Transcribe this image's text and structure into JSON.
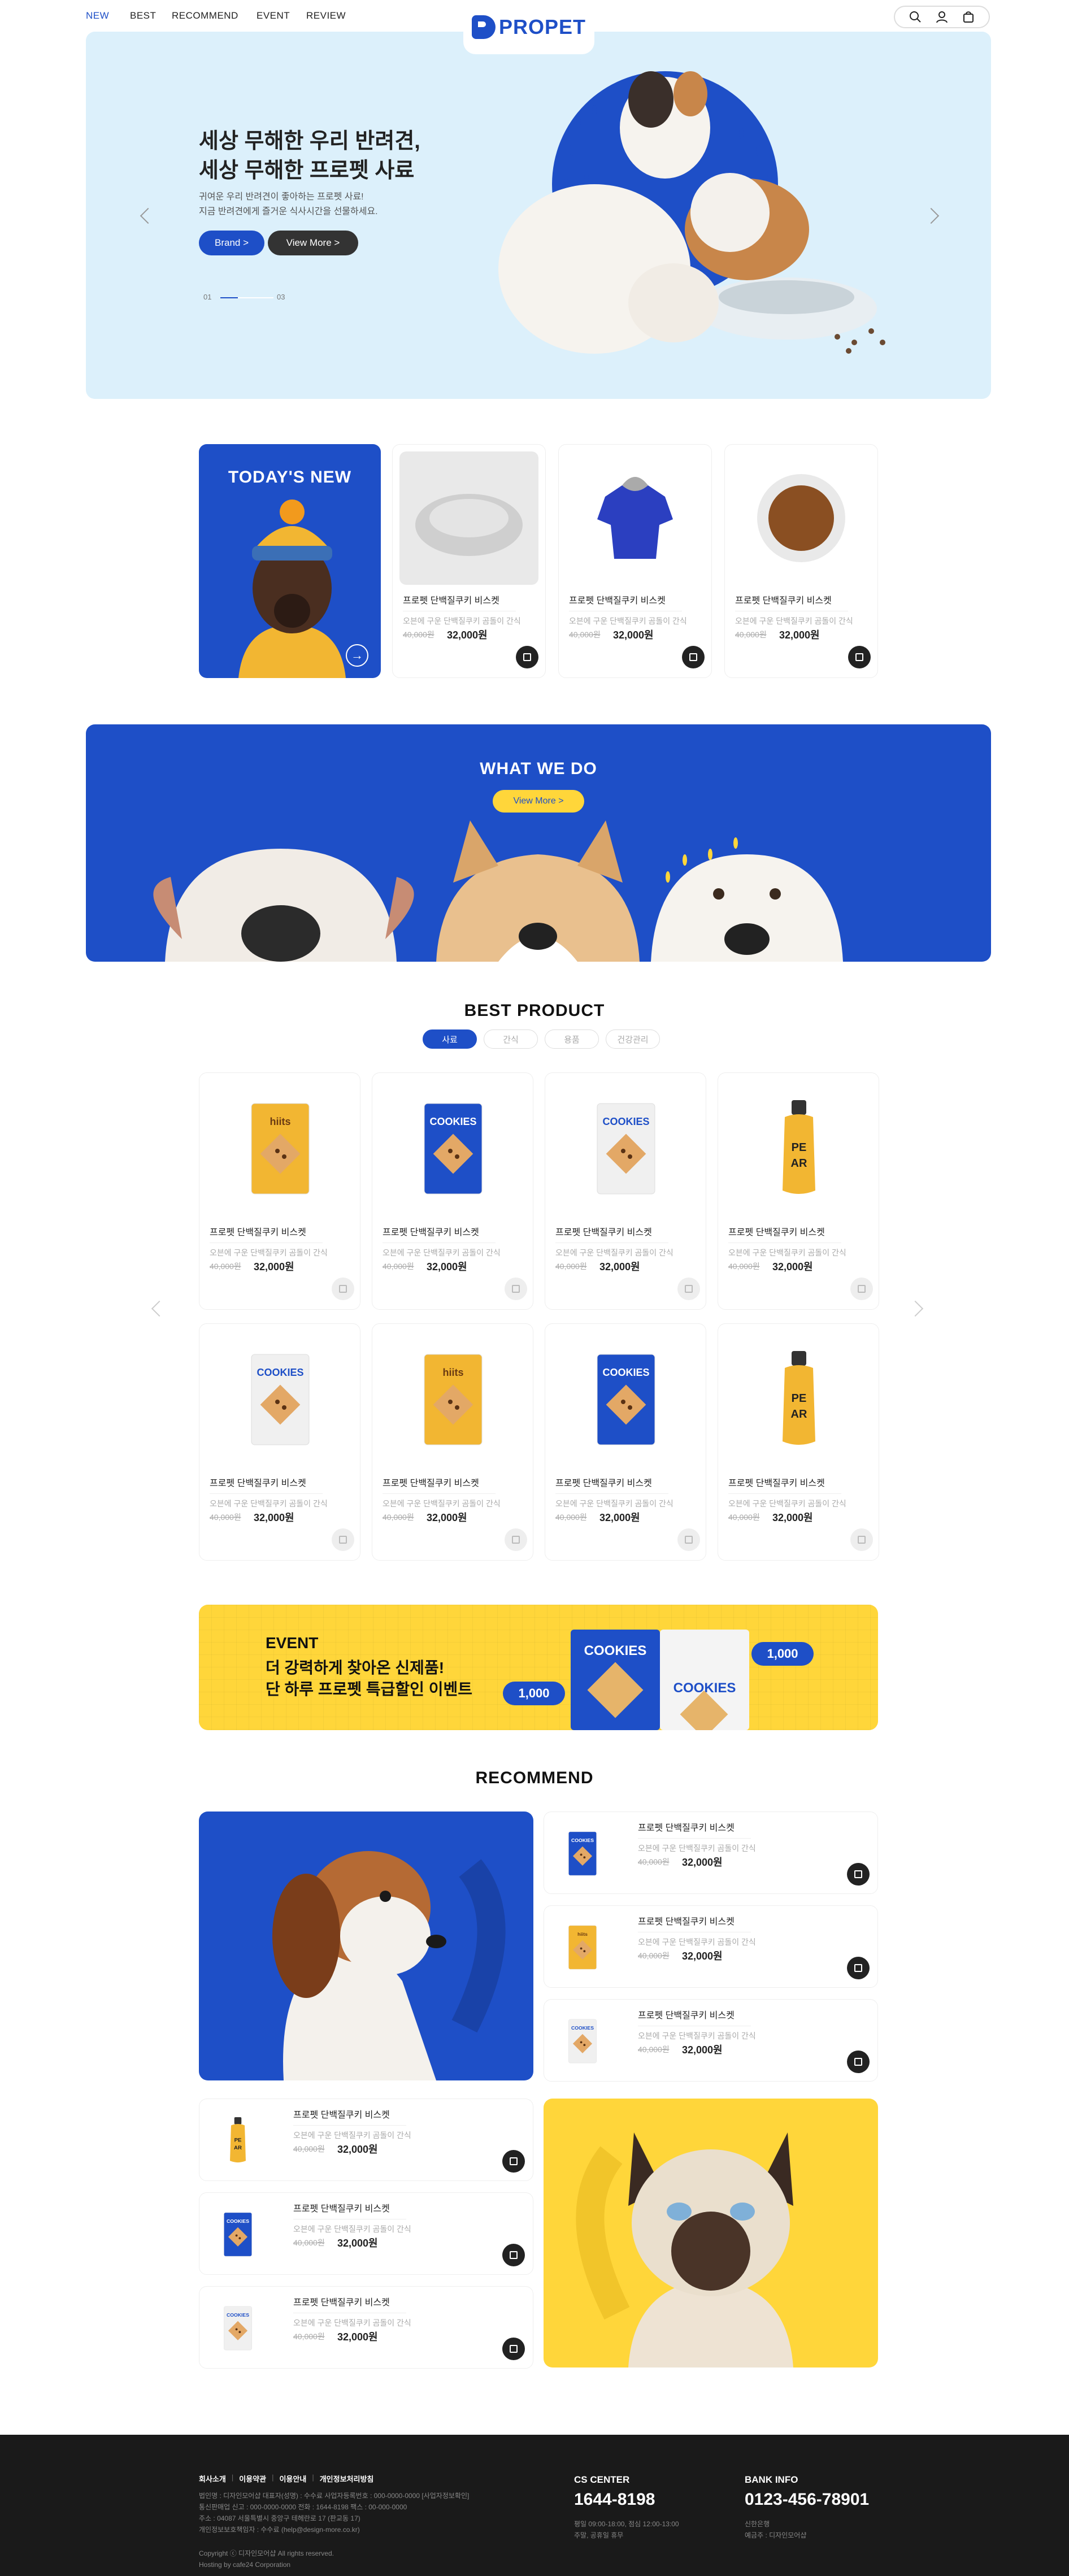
{
  "nav": {
    "items": [
      "NEW",
      "BEST",
      "RECOMMEND",
      "EVENT",
      "REVIEW"
    ],
    "active": "NEW",
    "logo": "PROPET"
  },
  "hero": {
    "title": "세상 무해한 우리 반려견,\n세상 무해한 프로펫 사료",
    "desc": "귀여운 우리 반려견이 좋아하는 프로펫 사료!\n지금 반려견에게 즐거운 식사시간을 선물하세요.",
    "btn_brand": "Brand >",
    "btn_more": "View More >",
    "page_current": "01",
    "page_total": "03",
    "progress": 0.33
  },
  "today": {
    "title": "TODAY'S NEW",
    "products": [
      {
        "name": "프로펫 단백질쿠키 비스켓",
        "desc": "오븐에 구운 단백질쿠키 곰돌이 간식",
        "old": "40,000원",
        "price": "32,000원",
        "icon": "pet-bed"
      },
      {
        "name": "프로펫 단백질쿠키 비스켓",
        "desc": "오븐에 구운 단백질쿠키 곰돌이 간식",
        "old": "40,000원",
        "price": "32,000원",
        "icon": "pet-hoodie"
      },
      {
        "name": "프로펫 단백질쿠키 비스켓",
        "desc": "오븐에 구운 단백질쿠키 곰돌이 간식",
        "old": "40,000원",
        "price": "32,000원",
        "icon": "food-bowl"
      }
    ]
  },
  "wwd": {
    "title": "WHAT WE DO",
    "btn": "View More >"
  },
  "best": {
    "title": "BEST PRODUCT",
    "tabs": [
      "사료",
      "간식",
      "용품",
      "건강관리"
    ],
    "products": [
      {
        "name": "프로펫 단백질쿠키 비스켓",
        "desc": "오븐에 구운 단백질쿠키 곰돌이 간식",
        "old": "40,000원",
        "price": "32,000원",
        "pack": "yellow",
        "label": "hiits"
      },
      {
        "name": "프로펫 단백질쿠키 비스켓",
        "desc": "오븐에 구운 단백질쿠키 곰돌이 간식",
        "old": "40,000원",
        "price": "32,000원",
        "pack": "blue",
        "label": "COOKIES"
      },
      {
        "name": "프로펫 단백질쿠키 비스켓",
        "desc": "오븐에 구운 단백질쿠키 곰돌이 간식",
        "old": "40,000원",
        "price": "32,000원",
        "pack": "white",
        "label": "COOKIES"
      },
      {
        "name": "프로펫 단백질쿠키 비스켓",
        "desc": "오븐에 구운 단백질쿠키 곰돌이 간식",
        "old": "40,000원",
        "price": "32,000원",
        "pack": "bottle",
        "label": "PEAR"
      },
      {
        "name": "프로펫 단백질쿠키 비스켓",
        "desc": "오븐에 구운 단백질쿠키 곰돌이 간식",
        "old": "40,000원",
        "price": "32,000원",
        "pack": "white",
        "label": "COOKIES"
      },
      {
        "name": "프로펫 단백질쿠키 비스켓",
        "desc": "오븐에 구운 단백질쿠키 곰돌이 간식",
        "old": "40,000원",
        "price": "32,000원",
        "pack": "yellow",
        "label": "hiits"
      },
      {
        "name": "프로펫 단백질쿠키 비스켓",
        "desc": "오븐에 구운 단백질쿠키 곰돌이 간식",
        "old": "40,000원",
        "price": "32,000원",
        "pack": "blue",
        "label": "COOKIES"
      },
      {
        "name": "프로펫 단백질쿠키 비스켓",
        "desc": "오븐에 구운 단백질쿠키 곰돌이 간식",
        "old": "40,000원",
        "price": "32,000원",
        "pack": "bottle",
        "label": "PEAR"
      }
    ]
  },
  "event": {
    "tag": "EVENT",
    "line1": "더 강력하게 찾아온 신제품!",
    "line2": "단 하루 프로펫 특급할인 이벤트",
    "bubble1": "1,000",
    "bubble2": "1,000",
    "pack_label": "COOKIES"
  },
  "recommend": {
    "title": "RECOMMEND",
    "right": [
      {
        "name": "프로펫 단백질쿠키 비스켓",
        "desc": "오븐에 구운 단백질쿠키 곰돌이 간식",
        "old": "40,000원",
        "price": "32,000원",
        "pack": "blue"
      },
      {
        "name": "프로펫 단백질쿠키 비스켓",
        "desc": "오븐에 구운 단백질쿠키 곰돌이 간식",
        "old": "40,000원",
        "price": "32,000원",
        "pack": "yellow"
      },
      {
        "name": "프로펫 단백질쿠키 비스켓",
        "desc": "오븐에 구운 단백질쿠키 곰돌이 간식",
        "old": "40,000원",
        "price": "32,000원",
        "pack": "white"
      }
    ],
    "left": [
      {
        "name": "프로펫 단백질쿠키 비스켓",
        "desc": "오븐에 구운 단백질쿠키 곰돌이 간식",
        "old": "40,000원",
        "price": "32,000원",
        "pack": "bottle"
      },
      {
        "name": "프로펫 단백질쿠키 비스켓",
        "desc": "오븐에 구운 단백질쿠키 곰돌이 간식",
        "old": "40,000원",
        "price": "32,000원",
        "pack": "blue"
      },
      {
        "name": "프로펫 단백질쿠키 비스켓",
        "desc": "오븐에 구운 단백질쿠키 곰돌이 간식",
        "old": "40,000원",
        "price": "32,000원",
        "pack": "white"
      }
    ]
  },
  "footer": {
    "links": [
      "회사소개",
      "이용약관",
      "이용안내",
      "개인정보처리방침"
    ],
    "info": "법인명 : 디자인모어샵 대표자(성명) : 수수료 사업자등록번호 : 000-0000-0000 [사업자정보확인]\n통신판매업 신고 : 000-0000-0000 전화 : 1644-8198 팩스 : 00-000-0000\n주소 : 04087 서울특별시 중앙구 테헤란로 17 (판교동 17)\n개인정보보호책임자 : 수수료 (help@design-more.co.kr)",
    "copyright": "Copyright ⓒ 디자인모어샵 All rights reserved.\nHosting by cafe24 Corporation",
    "cs_title": "CS CENTER",
    "cs_phone": "1644-8198",
    "cs_hours": "평일 09:00-18:00, 점심 12:00-13:00\n주말, 공휴일 휴무",
    "bank_title": "BANK INFO",
    "bank_num": "0123-456-78901",
    "bank_info": "신한은행\n예금주 : 디자인모어샵"
  },
  "colors": {
    "brand": "#1e4fc7",
    "accent": "#ffd63a",
    "footer": "#1a1a1a"
  }
}
